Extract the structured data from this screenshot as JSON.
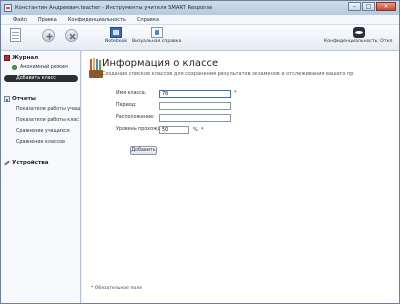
{
  "window": {
    "title": "Константин Андреевич.teacher - Инструменты учителя SMART Response"
  },
  "menu": [
    "Файл",
    "Правка",
    "Конфиденциальность",
    "Справка"
  ],
  "toolbar": {
    "notebook_label": "Notebook",
    "help_label": "Визуальная справка",
    "privacy_label": "Конфиденциальность: Откл."
  },
  "sidebar": {
    "journal": {
      "header": "Журнал",
      "anon_mode": "Анонимный режим",
      "add_class": "Добавить класс"
    },
    "reports": {
      "header": "Отчеты",
      "items": [
        "Показатели работы учащ",
        "Показатели работы клас",
        "Сравнение учащихся",
        "Сравнение классов"
      ]
    },
    "devices": {
      "header": "Устройства"
    }
  },
  "main": {
    "title": "Информация о классе",
    "subtitle": "Создание списков классов для сохранения результатов экзаменов и отслеживания вашего пр",
    "form": {
      "class_name_label": "Имя класса:",
      "class_name_value": "7б",
      "period_label": "Период:",
      "period_value": "",
      "location_label": "Расположение:",
      "location_value": "",
      "pass_level_label": "Уровень прохождения:",
      "pass_level_value": "50",
      "percent": "%",
      "asterisk": "*",
      "add_button": "Добавить"
    },
    "required_note": "* Обязательное поле"
  },
  "colors": {
    "accent": "#3a6fc0",
    "active_sidebar": "#2b2f36",
    "journal_icon": "#b32d24",
    "online_dot": "#3fae3a"
  }
}
